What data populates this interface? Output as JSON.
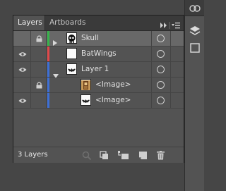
{
  "panel": {
    "tabs": [
      {
        "label": "Layers"
      },
      {
        "label": "Artboards"
      }
    ]
  },
  "layers": [
    {
      "name": "Skull",
      "visible": false,
      "locked": true,
      "expanded": false,
      "has_children": true,
      "indent": 0,
      "color": "#36b34a",
      "thumb": "skull",
      "selected": true
    },
    {
      "name": "BatWings",
      "visible": true,
      "locked": false,
      "expanded": false,
      "has_children": false,
      "indent": 0,
      "color": "#e0484a",
      "thumb": "blank",
      "selected": false
    },
    {
      "name": "Layer 1",
      "visible": true,
      "locked": false,
      "expanded": true,
      "has_children": true,
      "indent": 0,
      "color": "#3d6fd6",
      "thumb": "bat",
      "selected": false
    },
    {
      "name": "<Image>",
      "visible": false,
      "locked": true,
      "expanded": false,
      "has_children": false,
      "indent": 1,
      "color": "#3d6fd6",
      "thumb": "figure",
      "selected": false
    },
    {
      "name": "<Image>",
      "visible": true,
      "locked": false,
      "expanded": false,
      "has_children": false,
      "indent": 1,
      "color": "#3d6fd6",
      "thumb": "bat",
      "selected": false
    }
  ],
  "footer": {
    "count_label": "3 Layers"
  },
  "icons": [
    "eye-icon",
    "lock-icon",
    "expand-arrow-icon",
    "target-circle-icon",
    "panel-menu-icon",
    "collapse-panel-icon",
    "locate-object-icon",
    "make-clipping-mask-icon",
    "create-sublayer-icon",
    "new-layer-icon",
    "trash-icon",
    "creative-cloud-icon",
    "libraries-icon"
  ]
}
